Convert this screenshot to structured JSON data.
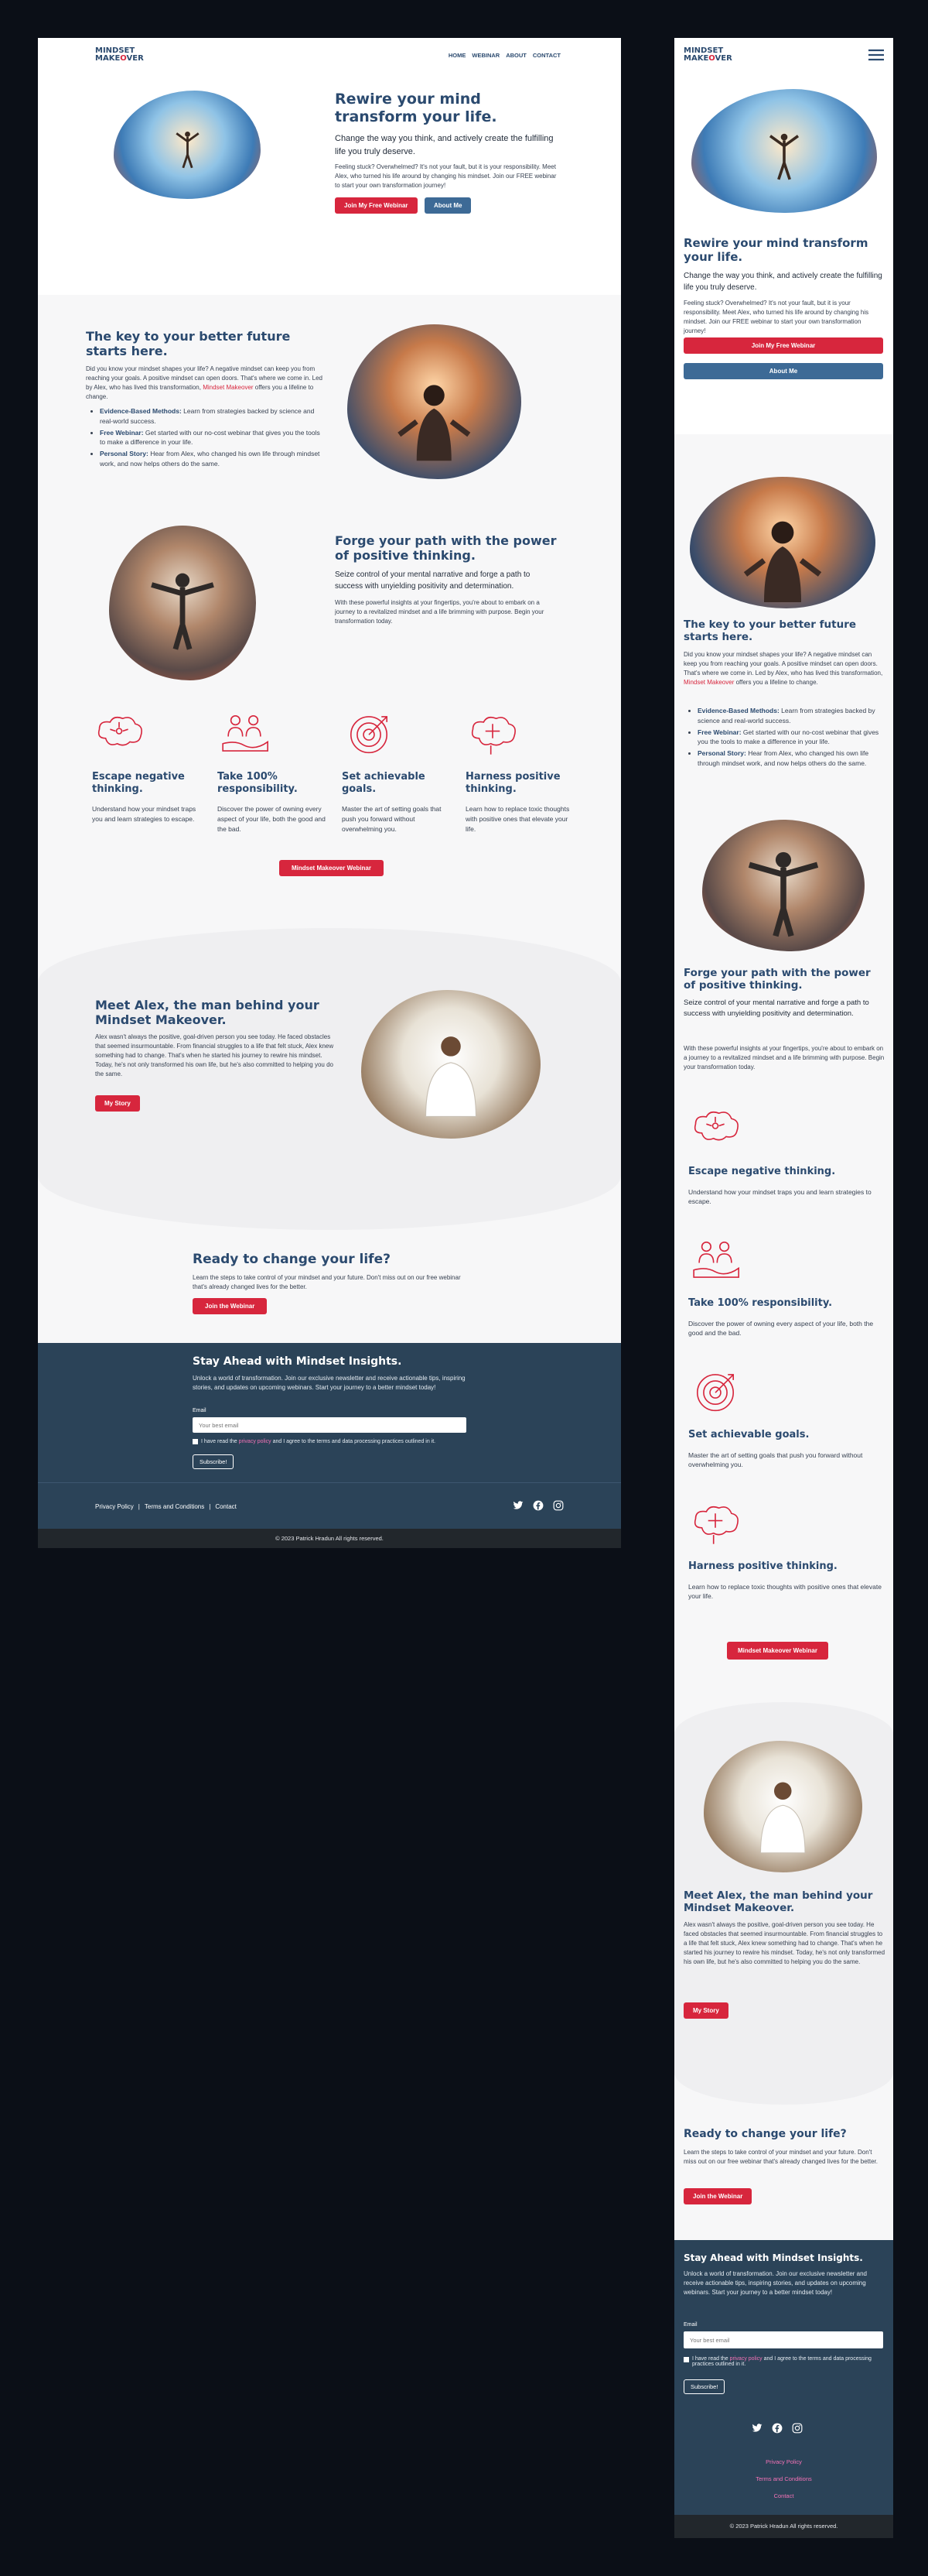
{
  "brand": {
    "line1": "MINDSET",
    "line2a": "MAKE",
    "line2b": "O",
    "line2c": "VER"
  },
  "nav": {
    "items": [
      "HOME",
      "WEBINAR",
      "ABOUT",
      "CONTACT"
    ]
  },
  "hero": {
    "title": "Rewire your mind transform your life.",
    "subtitle": "Change the way you think, and actively create the fulfilling life you truly deserve.",
    "body": "Feeling stuck? Overwhelmed? It's not your fault, but it is your responsibility. Meet Alex, who turned his life around by changing his mindset. Join our FREE webinar to start your own transformation journey!",
    "primary_button": "Join My Free Webinar",
    "secondary_button": "About Me"
  },
  "key": {
    "title": "The key to your better future starts here.",
    "body": "Did you know your mindset shapes your life? A negative mindset can keep you from reaching your goals. A positive mindset can open doors. That's where we come in. Led by Alex, who has lived this transformation,",
    "body_link": "Mindset Makeover",
    "body_tail": "offers you a lifeline to change.",
    "bullets": [
      {
        "bold": "Evidence-Based Methods:",
        "text": " Learn from strategies backed by science and real-world success."
      },
      {
        "bold": "Free Webinar:",
        "text": " Get started with our no-cost webinar that gives you the tools to make a difference in your life."
      },
      {
        "bold": "Personal Story:",
        "text": " Hear from Alex, who changed his own life through mindset work, and now helps others do the same."
      }
    ]
  },
  "forge": {
    "title": "Forge your path with the power of positive thinking.",
    "subtitle": "Seize control of your mental narrative and forge a path to success with unyielding positivity and determination.",
    "body": "With these powerful insights at your fingertips, you're about to embark on a journey to a revitalized mindset and a life brimming with purpose. Begin your transformation today."
  },
  "features": [
    {
      "title": "Escape negative thinking.",
      "text": "Understand how your mindset traps you and learn strategies to escape."
    },
    {
      "title": "Take 100% responsibility.",
      "text": "Discover the power of owning every aspect of your life, both the good and the bad."
    },
    {
      "title": "Set achievable goals.",
      "text": "Master the art of setting goals that push you forward without overwhelming you."
    },
    {
      "title": "Harness positive thinking.",
      "text": "Learn how to replace toxic thoughts with positive ones that elevate your life."
    }
  ],
  "features_button": "Mindset Makeover Webinar",
  "alex": {
    "title": "Meet Alex, the man behind your Mindset Makeover.",
    "body": "Alex wasn't always the positive, goal-driven person you see today. He faced obstacles that seemed insurmountable. From financial struggles to a life that felt stuck, Alex knew something had to change. That's when he started his journey to rewire his mindset. Today, he's not only transformed his own life, but he's also committed to helping you do the same.",
    "button": "My Story"
  },
  "cta": {
    "title": "Ready to change your life?",
    "body": "Learn the steps to take control of your mindset and your future. Don't miss out on our free webinar that's already changed lives for the better.",
    "button": "Join the Webinar"
  },
  "newsletter": {
    "title": "Stay Ahead with Mindset Insights.",
    "body": "Unlock a world of transformation. Join our exclusive newsletter and receive actionable tips, inspiring stories, and updates on upcoming webinars. Start your journey to a better mindset today!",
    "email_label": "Email",
    "email_placeholder": "Your best email",
    "consent_pre": "I have read the ",
    "consent_link": "privacy policy",
    "consent_post": " and I agree to the terms and data processing practices outlined in it.",
    "button": "Subscribe!"
  },
  "footer": {
    "links": [
      "Privacy Policy",
      "Terms and Conditions",
      "Contact"
    ],
    "copyright": "© 2023 Patrick Hradun All rights reserved.",
    "social_icons": [
      "twitter-icon",
      "facebook-icon",
      "instagram-icon"
    ]
  },
  "colors": {
    "navy": "#2b4a6f",
    "red": "#d7263d",
    "footer": "#2b4358",
    "bar": "#22272c"
  }
}
